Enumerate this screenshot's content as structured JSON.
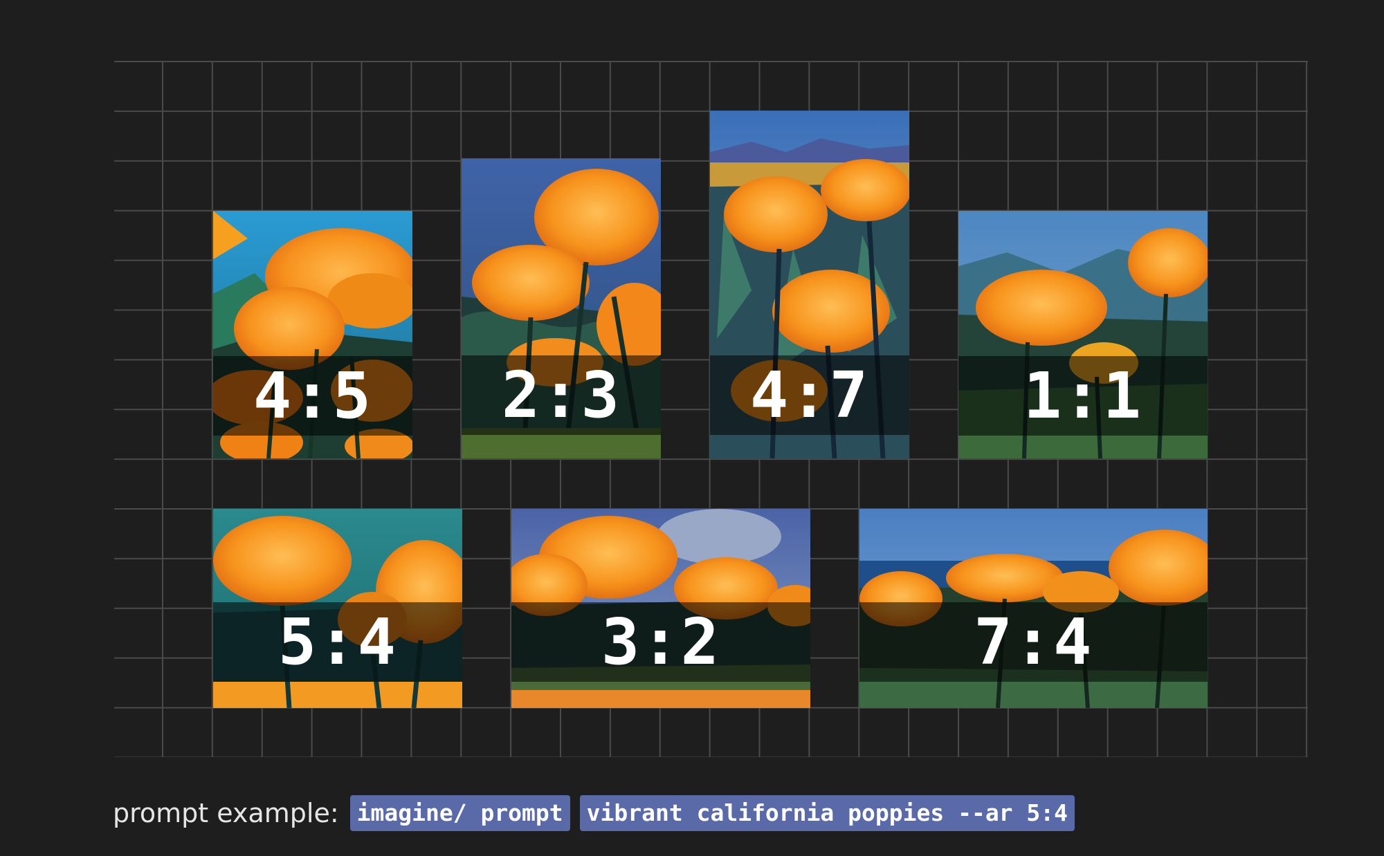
{
  "tiles": [
    {
      "label": "4:5"
    },
    {
      "label": "2:3"
    },
    {
      "label": "4:7"
    },
    {
      "label": "1:1"
    },
    {
      "label": "5:4"
    },
    {
      "label": "3:2"
    },
    {
      "label": "7:4"
    }
  ],
  "prompt": {
    "label": "prompt example:",
    "command": "imagine/ prompt",
    "text": "vibrant california poppies --ar 5:4"
  },
  "colors": {
    "background": "#1e1e1e",
    "grid_line": "#4a4a4a",
    "chip": "#5a6aa8",
    "poppy": "#f7941d"
  }
}
